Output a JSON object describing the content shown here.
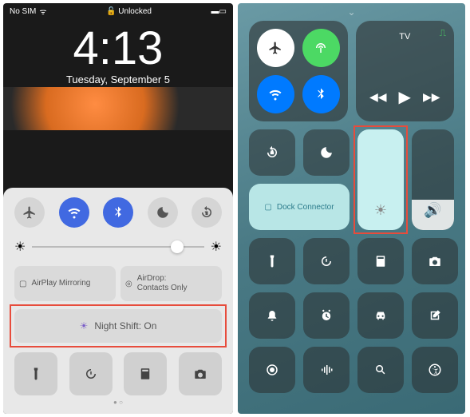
{
  "left": {
    "status": {
      "carrier": "No SIM",
      "wifi": "≈",
      "lock_label": "Unlocked",
      "battery_icon": "battery"
    },
    "clock": {
      "time": "4:13",
      "date": "Tuesday, September 5"
    },
    "toggles": {
      "airplane": "airplane",
      "wifi": "wifi",
      "bluetooth": "bluetooth",
      "dnd": "moon",
      "rotation": "rotation-lock"
    },
    "slider": {
      "low": "sun-low",
      "high": "sun-high",
      "value": 88
    },
    "airplay": {
      "label": "AirPlay Mirroring"
    },
    "airdrop": {
      "label": "AirDrop:",
      "value": "Contacts Only"
    },
    "nightshift": {
      "label": "Night Shift: On"
    },
    "shortcuts": {
      "flashlight": "flashlight",
      "timer": "timer",
      "calculator": "calculator",
      "camera": "camera"
    }
  },
  "right": {
    "connectivity": {
      "airplane": "airplane",
      "cellular": "antenna",
      "wifi": "wifi",
      "bluetooth": "bluetooth"
    },
    "media": {
      "title": "TV",
      "cast": "cast-icon",
      "prev": "◀◀",
      "play": "▶",
      "next": "▶▶"
    },
    "rotation": "rotation-lock",
    "dnd": "moon",
    "dock": {
      "label": "Dock Connector"
    },
    "brightness": {
      "icon": "sun",
      "value": 100
    },
    "volume": {
      "icon": "speaker",
      "value": 30
    },
    "grid": [
      "flashlight",
      "timer",
      "calculator",
      "camera",
      "silent",
      "alarm",
      "car",
      "compose",
      "record",
      "waveform",
      "magnify",
      "accessibility"
    ]
  }
}
